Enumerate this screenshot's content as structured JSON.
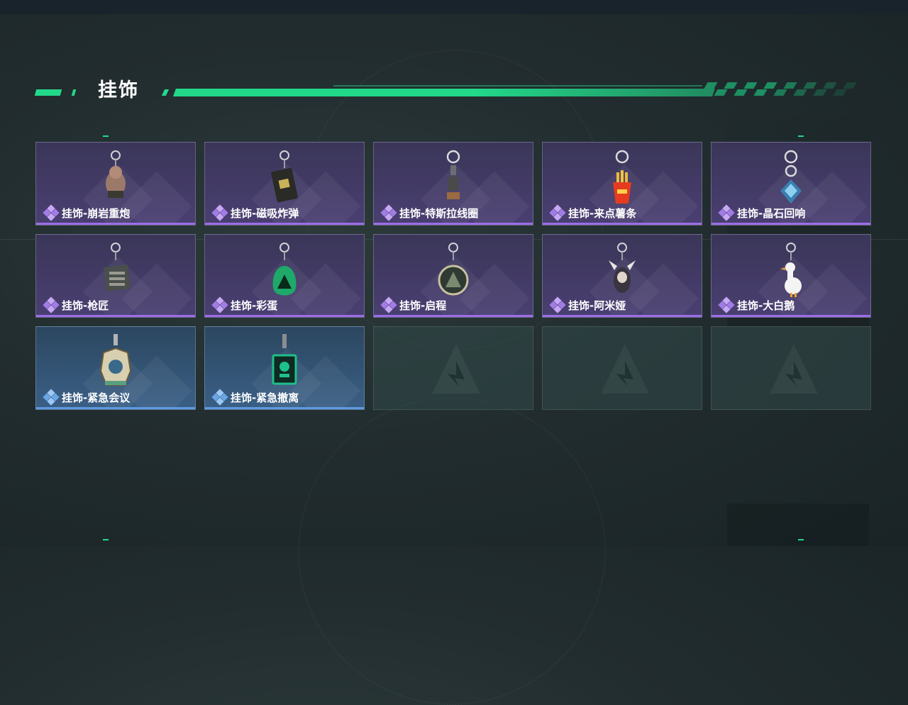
{
  "section": {
    "title": "挂饰"
  },
  "colors": {
    "accent": "#22d98a",
    "rare_purple": "#9b6ee6",
    "rare_blue": "#5e9be0"
  },
  "slots": [
    {
      "name": "挂饰-崩岩重炮",
      "rarity": "purple",
      "icon": "rock-soldier-charm"
    },
    {
      "name": "挂饰-磁吸炸弹",
      "rarity": "purple",
      "icon": "magnetic-bomb-charm"
    },
    {
      "name": "挂饰-特斯拉线圈",
      "rarity": "purple",
      "icon": "tesla-coil-charm"
    },
    {
      "name": "挂饰-来点薯条",
      "rarity": "purple",
      "icon": "fries-charm"
    },
    {
      "name": "挂饰-晶石回响",
      "rarity": "purple",
      "icon": "crystal-charm"
    },
    {
      "name": "挂饰-枪匠",
      "rarity": "purple",
      "icon": "gunsmith-charm"
    },
    {
      "name": "挂饰-彩蛋",
      "rarity": "purple",
      "icon": "easter-egg-charm"
    },
    {
      "name": "挂饰-启程",
      "rarity": "purple",
      "icon": "depart-badge-charm"
    },
    {
      "name": "挂饰-阿米娅",
      "rarity": "purple",
      "icon": "amiya-charm"
    },
    {
      "name": "挂饰-大白鹅",
      "rarity": "purple",
      "icon": "white-goose-charm"
    },
    {
      "name": "挂饰-紧急会议",
      "rarity": "blue",
      "icon": "emergency-meeting-charm"
    },
    {
      "name": "挂饰-紧急撤离",
      "rarity": "blue",
      "icon": "emergency-evac-charm"
    },
    {
      "name": "",
      "rarity": "empty",
      "icon": "empty-logo-icon"
    },
    {
      "name": "",
      "rarity": "empty",
      "icon": "empty-logo-icon"
    },
    {
      "name": "",
      "rarity": "empty",
      "icon": "empty-logo-icon"
    }
  ]
}
